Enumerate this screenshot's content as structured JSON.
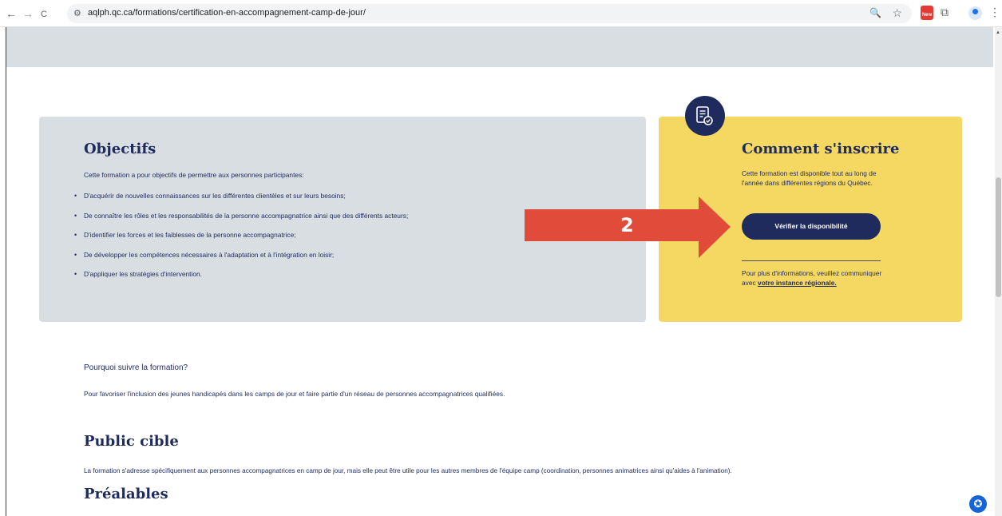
{
  "browser": {
    "back_icon": "←",
    "forward_icon": "→",
    "reload_icon": "C",
    "site_info_icon": "⚙",
    "url": "aqlph.qc.ca/formations/certification-en-accompagnement-camp-de-jour/",
    "zoom_icon": "🔍",
    "bookmark_icon": "☆",
    "extension_new_label": "New",
    "puzzle_icon": "⧉",
    "menu_icon": "⋮"
  },
  "objectifs": {
    "title": "Objectifs",
    "intro": "Cette formation a pour objectifs de permettre aux personnes participantes:",
    "items": [
      "D'acquérir de nouvelles connaissances sur les différentes clientèles et sur leurs besoins;",
      "De connaître les rôles et les responsabilités de la personne accompagnatrice ainsi que des différents acteurs;",
      "D'identifier les forces et les faiblesses de la personne accompagnatrice;",
      "De développer les compétences nécessaires à l'adaptation et à l'intégration en loisir;",
      "D'appliquer les stratégies d'intervention."
    ]
  },
  "inscrire": {
    "title": "Comment s'inscrire",
    "description": "Cette formation est disponible tout au long de l'année dans différentes régions du Québec.",
    "button_label": "Vérifier la disponibilité",
    "more_prefix": "Pour plus d'informations, veuillez communiquer avec ",
    "more_link": "votre instance régionale."
  },
  "annotation": {
    "step_number": "2",
    "arrow_color": "#e04b3a"
  },
  "pourquoi": {
    "title": "Pourquoi suivre la formation?",
    "text": "Pour favoriser l'inclusion des jeunes handicapés dans les camps de jour et faire partie d'un réseau de personnes accompagnatrices qualifiées."
  },
  "public_cible": {
    "title": "Public cible",
    "text": "La formation s'adresse spécifiquement aux personnes accompagnatrices en camp de jour, mais elle peut être utile pour les autres membres de l'équipe camp (coordination, personnes animatrices ainsi qu'aides à l'animation)."
  },
  "prealables": {
    "title": "Préalables"
  },
  "accessibility_icon": "✪"
}
